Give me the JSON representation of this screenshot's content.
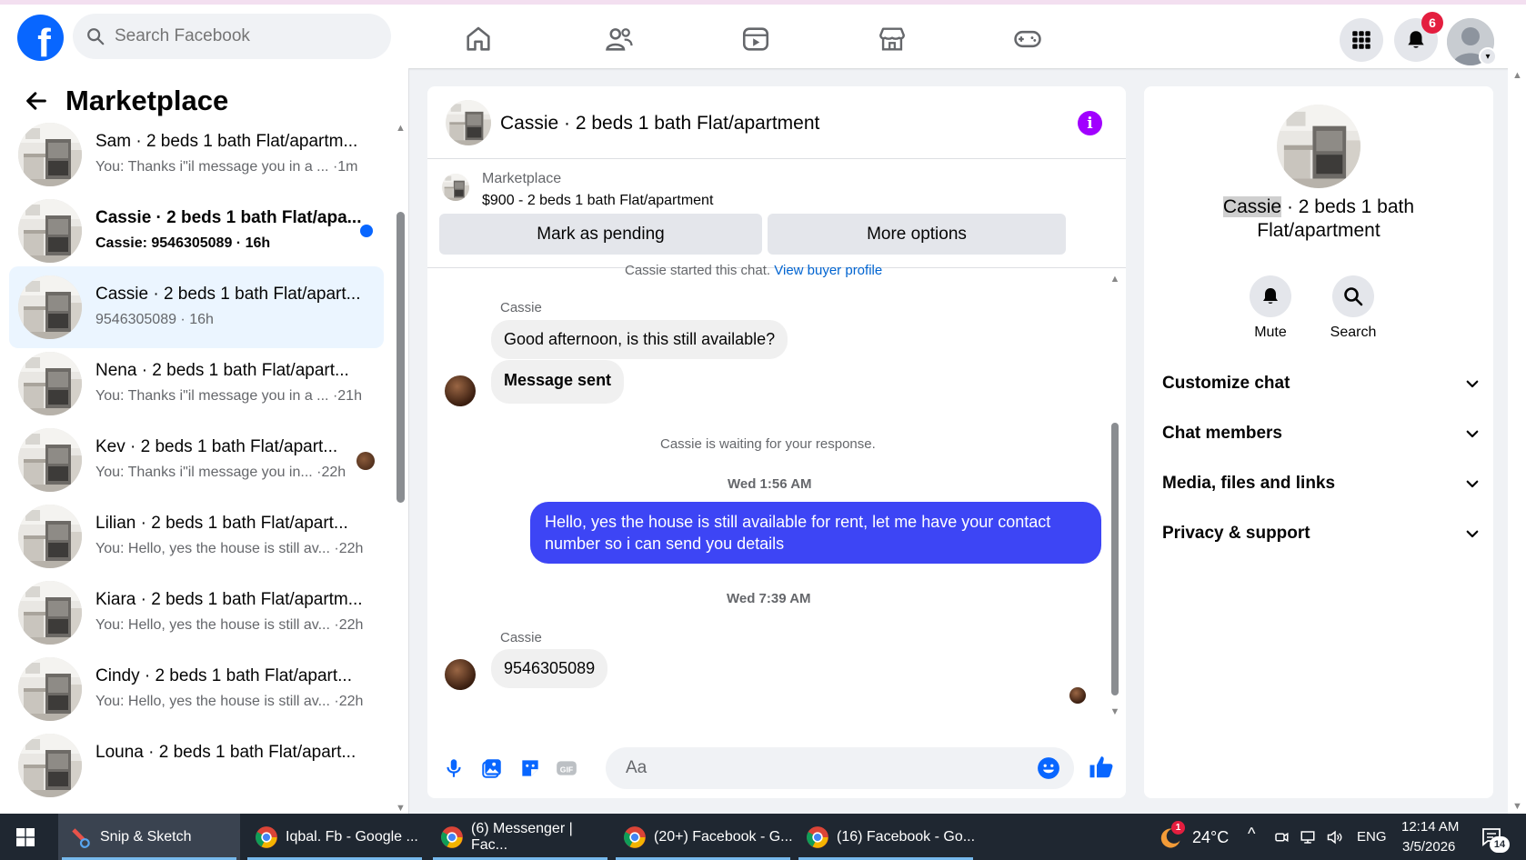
{
  "topbar": {
    "search_placeholder": "Search Facebook",
    "notification_count": "6",
    "logo_letter": "f"
  },
  "sidebar": {
    "title": "Marketplace",
    "conversations": [
      {
        "title": "Sam · 2 beds 1 bath Flat/apartm...",
        "subtitle": "You: Thanks i\"il message you in a ...  ·1m",
        "unread": false
      },
      {
        "title": "Cassie · 2 beds 1 bath Flat/apa...",
        "subtitle": "Cassie: 9546305089 · 16h",
        "unread": true
      },
      {
        "title": "Cassie · 2 beds 1 bath Flat/apart...",
        "subtitle": "9546305089 · 16h",
        "unread": false,
        "active": true
      },
      {
        "title": "Nena · 2 beds 1 bath Flat/apart...",
        "subtitle": "You: Thanks i\"il message you in a ... ·21h",
        "unread": false
      },
      {
        "title": "Kev · 2 beds 1 bath Flat/apart...",
        "subtitle": "You: Thanks i\"il message you in... ·22h",
        "unread": false
      },
      {
        "title": "Lilian · 2 beds 1 bath Flat/apart...",
        "subtitle": "You: Hello, yes the house is still av... ·22h",
        "unread": false
      },
      {
        "title": "Kiara · 2 beds 1 bath Flat/apartm...",
        "subtitle": "You: Hello, yes the house is still av... ·22h",
        "unread": false
      },
      {
        "title": "Cindy · 2 beds 1 bath Flat/apart...",
        "subtitle": "You: Hello, yes the house is still av... ·22h",
        "unread": false
      },
      {
        "title": "Louna · 2 beds 1 bath Flat/apart...",
        "subtitle": "",
        "unread": false
      }
    ]
  },
  "chat": {
    "title": "Cassie · 2 beds 1 bath Flat/apartment",
    "listing_source": "Marketplace",
    "listing_desc": "$900 - 2 beds 1 bath Flat/apartment",
    "mark_pending_label": "Mark as pending",
    "more_options_label": "More options",
    "started_text": "Cassie started this chat.",
    "view_profile_link": "View buyer profile",
    "sender_1": "Cassie",
    "msg_1": "Good afternoon, is this still available?",
    "msg_2": "Message sent",
    "waiting_text": "Cassie is waiting for your response.",
    "time_1": "Wed 1:56 AM",
    "msg_out": "Hello, yes the house is still available for rent, let me have your contact number so i can send you details",
    "time_2": "Wed 7:39 AM",
    "sender_2": "Cassie",
    "msg_3": "9546305089",
    "composer_placeholder": "Aa"
  },
  "info_panel": {
    "name_highlight": "Cassie",
    "name_rest": " · 2 beds 1 bath Flat/apartment",
    "mute_label": "Mute",
    "search_label": "Search",
    "sections": [
      "Customize chat",
      "Chat members",
      "Media, files and links",
      "Privacy & support"
    ]
  },
  "taskbar": {
    "items": [
      "Snip & Sketch",
      "Iqbal. Fb - Google ...",
      "(6) Messenger | Fac...",
      "(20+) Facebook - G...",
      "(16) Facebook - Go..."
    ],
    "weather_badge": "1",
    "temperature": "24°C",
    "language": "ENG",
    "time": "12:14 AM",
    "date": "3/5/2026",
    "notif_count": "14"
  },
  "colors": {
    "brand": "#0866ff",
    "outgoing_bubble": "#3d45f5",
    "info_icon": "#a100ff",
    "badge": "#e41e3f"
  }
}
